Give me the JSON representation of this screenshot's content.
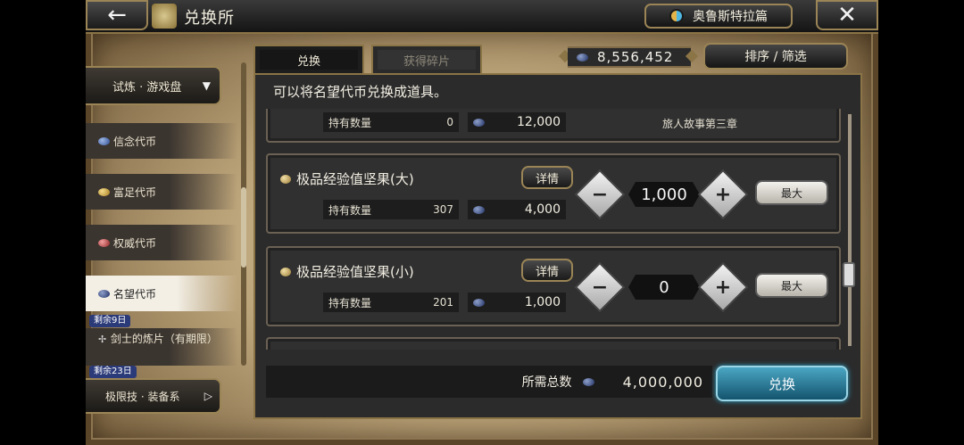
{
  "header": {
    "back_icon": "←",
    "title": "兑换所",
    "story_button": "奥鲁斯特拉篇",
    "close_icon": "✕"
  },
  "tabs": [
    {
      "label": "兑换",
      "active": true
    },
    {
      "label": "获得碎片",
      "active": false
    }
  ],
  "currency": {
    "amount": "8,556,452"
  },
  "sort_button": "排序 / 筛选",
  "sidebar": {
    "category": "试炼 · 游戏盘",
    "items": [
      {
        "label": "信念代币",
        "coin": "blue"
      },
      {
        "label": "富足代币",
        "coin": "gold"
      },
      {
        "label": "权威代币",
        "coin": "red"
      },
      {
        "label": "名望代币",
        "coin": "navy",
        "active": true
      }
    ],
    "remain_badge_1": "剩余9日",
    "item_5": {
      "label": "剑士的炼片（有期限）"
    },
    "remain_badge_2": "剩余23日",
    "bottom_category": "极限技 · 装备系"
  },
  "panel": {
    "description": "可以将名望代币兑换成道具。",
    "partial_card": {
      "held_label": "持有数量",
      "held_value": "0",
      "cost": "12,000",
      "chapter": "旅人故事第三章"
    },
    "items": [
      {
        "name": "极品经验值坚果(大)",
        "detail": "详情",
        "held_label": "持有数量",
        "held_value": "307",
        "cost": "4,000",
        "quantity": "1,000",
        "minus": "−",
        "plus": "+",
        "max": "最大"
      },
      {
        "name": "极品经验值坚果(小)",
        "detail": "详情",
        "held_label": "持有数量",
        "held_value": "201",
        "cost": "1,000",
        "quantity": "0",
        "minus": "−",
        "plus": "+",
        "max": "最大"
      }
    ],
    "total_label": "所需总数",
    "total_value": "4,000,000",
    "exchange_button": "兑换"
  }
}
